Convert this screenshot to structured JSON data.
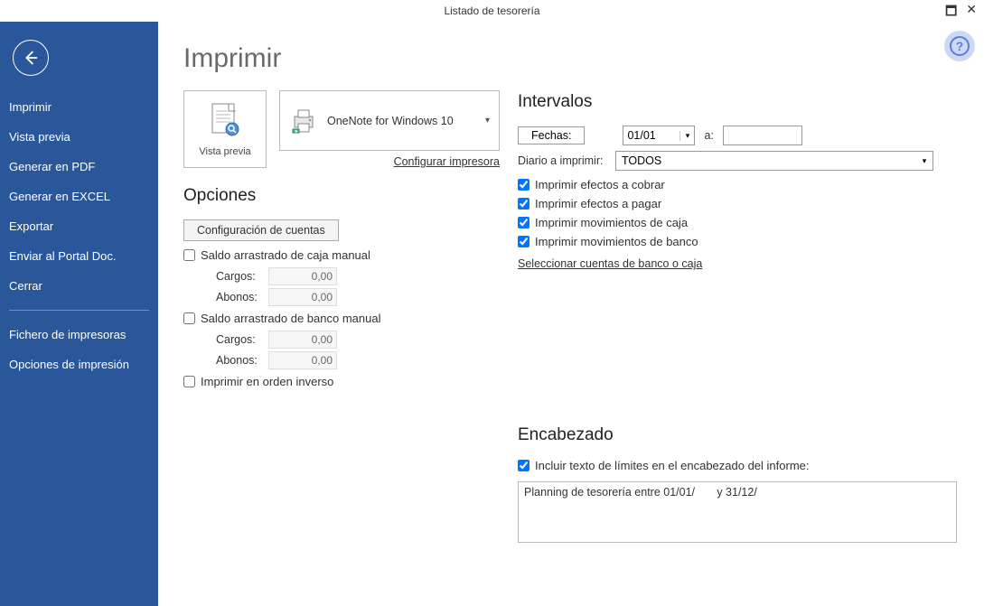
{
  "window": {
    "title": "Listado de tesorería"
  },
  "sidebar": {
    "items": [
      {
        "label": "Imprimir"
      },
      {
        "label": "Vista previa"
      },
      {
        "label": "Generar en PDF"
      },
      {
        "label": "Generar en EXCEL"
      },
      {
        "label": "Exportar"
      },
      {
        "label": "Enviar al Portal Doc."
      },
      {
        "label": "Cerrar"
      }
    ],
    "items2": [
      {
        "label": "Fichero de impresoras"
      },
      {
        "label": "Opciones de impresión"
      }
    ]
  },
  "main": {
    "title": "Imprimir",
    "preview_label": "Vista previa",
    "printer_name": "OneNote for Windows 10",
    "configure_printer": "Configurar impresora",
    "opciones_title": "Opciones",
    "config_cuentas_btn": "Configuración de cuentas",
    "chk_saldo_caja": "Saldo arrastrado de caja manual",
    "cargos_label": "Cargos:",
    "abonos_label": "Abonos:",
    "caja_cargos": "0,00",
    "caja_abonos": "0,00",
    "chk_saldo_banco": "Saldo arrastrado de banco manual",
    "banco_cargos": "0,00",
    "banco_abonos": "0,00",
    "chk_orden_inverso": "Imprimir en orden inverso"
  },
  "intervalos": {
    "title": "Intervalos",
    "fechas_btn": "Fechas:",
    "fecha_desde": "01/01",
    "a_label": "a:",
    "fecha_hasta": "",
    "diario_label": "Diario a imprimir:",
    "diario_value": "TODOS",
    "chk_cobrar": "Imprimir efectos a cobrar",
    "chk_pagar": "Imprimir efectos a pagar",
    "chk_caja": "Imprimir movimientos de caja",
    "chk_banco": "Imprimir movimientos de banco",
    "seleccionar_link": "Seleccionar cuentas de banco o caja"
  },
  "encabezado": {
    "title": "Encabezado",
    "chk_incluir": "Incluir texto de límites en el encabezado del informe:",
    "text_value": "Planning de tesorería entre 01/01/       y 31/12/"
  },
  "icons": {
    "maximize": "🗖",
    "close": "✕"
  }
}
